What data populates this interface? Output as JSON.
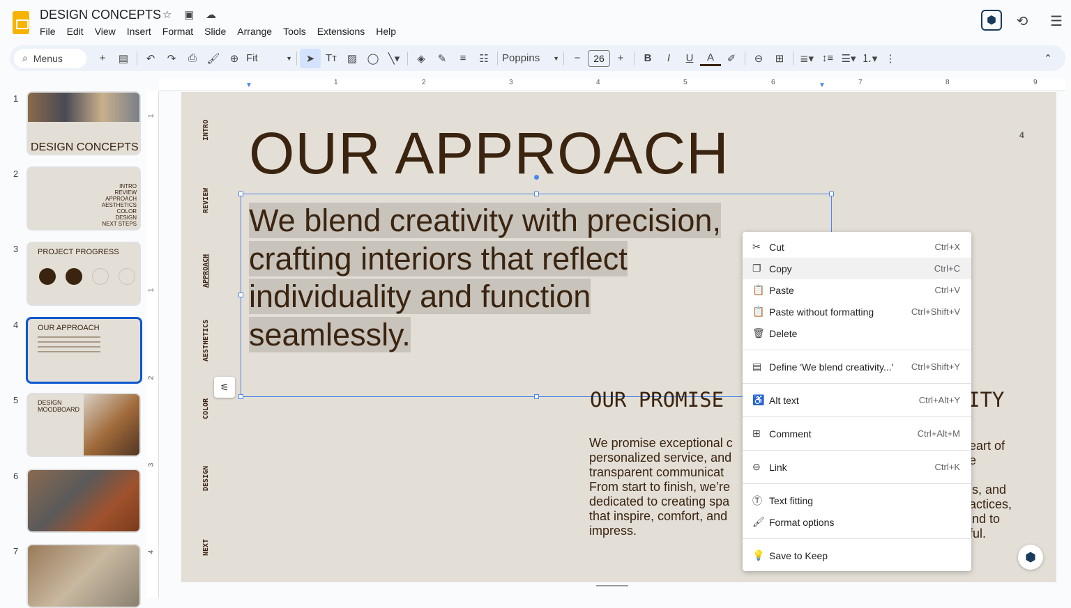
{
  "app": {
    "title": "DESIGN CONCEPTS",
    "menu": [
      "File",
      "Edit",
      "View",
      "Insert",
      "Format",
      "Slide",
      "Arrange",
      "Tools",
      "Extensions",
      "Help"
    ]
  },
  "toolbar": {
    "search_label": "Menus",
    "zoom": "Fit",
    "font": "Poppins",
    "font_size": "26",
    "text_color": "#3a2410"
  },
  "ruler": {
    "h": [
      "1",
      "2",
      "3",
      "4",
      "5",
      "6",
      "7",
      "8",
      "9"
    ],
    "v": [
      "1",
      "2",
      "3",
      "4"
    ]
  },
  "thumbnails": [
    {
      "num": "1",
      "title": "DESIGN CONCEPTS"
    },
    {
      "num": "2",
      "items": [
        "INTRO",
        "REVIEW",
        "APPROACH",
        "AESTHETICS",
        "COLOR",
        "DESIGN",
        "NEXT STEPS"
      ]
    },
    {
      "num": "3",
      "title": "PROJECT PROGRESS"
    },
    {
      "num": "4",
      "title": "OUR APPROACH"
    },
    {
      "num": "5",
      "title": "DESIGN MOODBOARD"
    },
    {
      "num": "6"
    },
    {
      "num": "7"
    }
  ],
  "slide": {
    "side_labels": [
      "INTRO",
      "REVIEW",
      "APPROACH",
      "AESTHETICS",
      "COLOR",
      "DESIGN",
      "NEXT"
    ],
    "title": "OUR APPROACH",
    "body_lines": [
      "We blend creativity with precision,",
      "crafting interiors that reflect",
      "individuality and function",
      "seamlessly."
    ],
    "promise_heading": "OUR PROMISE",
    "right_heading_fragment": "ITY",
    "promise_text": "We promise exceptional c\npersonalized service, and\ntransparent communicat\nFrom start to finish, we’re\ndedicated to creating spa\nthat inspire, comfort, and\nimpress.",
    "right_text_fragment": "eart of\ne\n\nis, and\nactices,\nind to\nful.",
    "page_number": "4",
    "bg": "#e3ded6"
  },
  "context_menu": {
    "items": [
      {
        "icon": "scissors-icon",
        "glyph": "✂",
        "label": "Cut",
        "shortcut": "Ctrl+X"
      },
      {
        "icon": "copy-icon",
        "glyph": "❐",
        "label": "Copy",
        "shortcut": "Ctrl+C"
      },
      {
        "icon": "paste-icon",
        "glyph": "📋",
        "label": "Paste",
        "shortcut": "Ctrl+V"
      },
      {
        "icon": "paste-plain-icon",
        "glyph": "📋",
        "label": "Paste without formatting",
        "shortcut": "Ctrl+Shift+V"
      },
      {
        "icon": "trash-icon",
        "glyph": "🗑",
        "label": "Delete",
        "shortcut": ""
      },
      {
        "icon": "define-icon",
        "glyph": "▤",
        "label": "Define 'We blend creativity...'",
        "shortcut": "Ctrl+Shift+Y"
      },
      {
        "icon": "accessibility-icon",
        "glyph": "♿",
        "label": "Alt text",
        "shortcut": "Ctrl+Alt+Y"
      },
      {
        "icon": "comment-icon",
        "glyph": "⊞",
        "label": "Comment",
        "shortcut": "Ctrl+Alt+M"
      },
      {
        "icon": "link-icon",
        "glyph": "⊖",
        "label": "Link",
        "shortcut": "Ctrl+K"
      },
      {
        "icon": "text-fitting-icon",
        "glyph": "Ⓣ",
        "label": "Text fitting",
        "shortcut": ""
      },
      {
        "icon": "format-paint-icon",
        "glyph": "🖌",
        "label": "Format options",
        "shortcut": ""
      },
      {
        "icon": "lightbulb-icon",
        "glyph": "💡",
        "label": "Save to Keep",
        "shortcut": ""
      }
    ]
  }
}
